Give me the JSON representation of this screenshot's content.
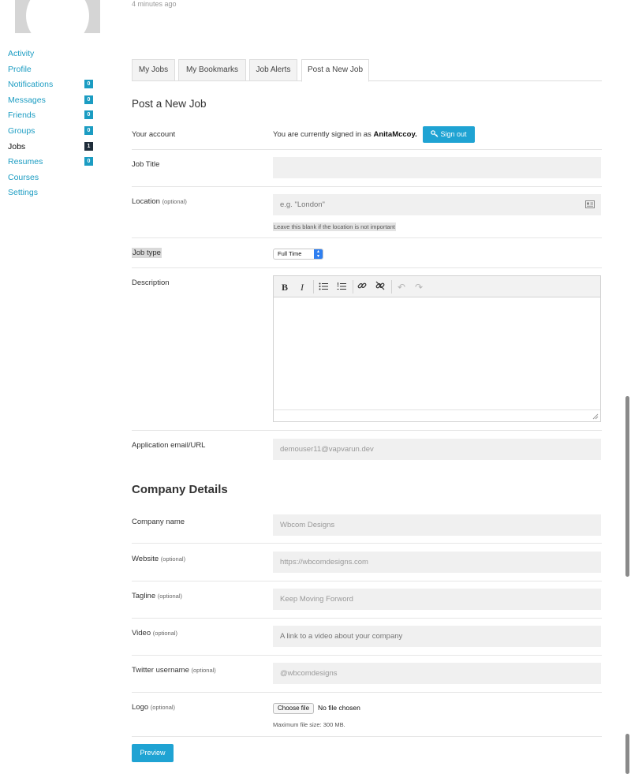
{
  "timestamp": "4 minutes ago",
  "sidebar": {
    "items": [
      {
        "label": "Activity",
        "badge": ""
      },
      {
        "label": "Profile",
        "badge": ""
      },
      {
        "label": "Notifications",
        "badge": "0"
      },
      {
        "label": "Messages",
        "badge": "0"
      },
      {
        "label": "Friends",
        "badge": "0"
      },
      {
        "label": "Groups",
        "badge": "0"
      },
      {
        "label": "Jobs",
        "badge": "1"
      },
      {
        "label": "Resumes",
        "badge": "0"
      },
      {
        "label": "Courses",
        "badge": ""
      },
      {
        "label": "Settings",
        "badge": ""
      }
    ]
  },
  "tabs": [
    "My Jobs",
    "My Bookmarks",
    "Job Alerts",
    "Post a New Job"
  ],
  "form": {
    "title": "Post a New Job",
    "account": {
      "label": "Your account",
      "prefix": "You are currently signed in as",
      "username": "AnitaMccoy.",
      "signout_label": "Sign out"
    },
    "job_title": {
      "label": "Job Title",
      "placeholder": ""
    },
    "location": {
      "label": "Location",
      "optional": "(optional)",
      "placeholder": "e.g. \"London\"",
      "hint": "Leave this blank if the location is not important"
    },
    "job_type": {
      "label": "Job type",
      "value": "Full Time"
    },
    "description": {
      "label": "Description"
    },
    "application": {
      "label": "Application email/URL",
      "value": "demouser11@vapvarun.dev"
    }
  },
  "company": {
    "title": "Company Details",
    "name": {
      "label": "Company name",
      "value": "Wbcom Designs"
    },
    "website": {
      "label": "Website",
      "optional": "(optional)",
      "value": "https://wbcomdesigns.com"
    },
    "tagline": {
      "label": "Tagline",
      "optional": "(optional)",
      "value": "Keep Moving Forword"
    },
    "video": {
      "label": "Video",
      "optional": "(optional)",
      "placeholder": "A link to a video about your company"
    },
    "twitter": {
      "label": "Twitter username",
      "optional": "(optional)",
      "value": "@wbcomdesigns"
    },
    "logo": {
      "label": "Logo",
      "optional": "(optional)",
      "choose_label": "Choose file",
      "no_file": "No file chosen",
      "max_size": "Maximum file size: 300 MB."
    }
  },
  "preview_label": "Preview",
  "colors": {
    "accent": "#1fa3d3",
    "link": "#1b9cc2",
    "field_bg": "#f0f0f0"
  },
  "icons": {
    "signout": "key-icon",
    "location": "address-card-icon",
    "toolbar": [
      "bold-icon",
      "italic-icon",
      "bullet-list-icon",
      "numbered-list-icon",
      "link-icon",
      "unlink-icon",
      "undo-icon",
      "redo-icon"
    ]
  }
}
